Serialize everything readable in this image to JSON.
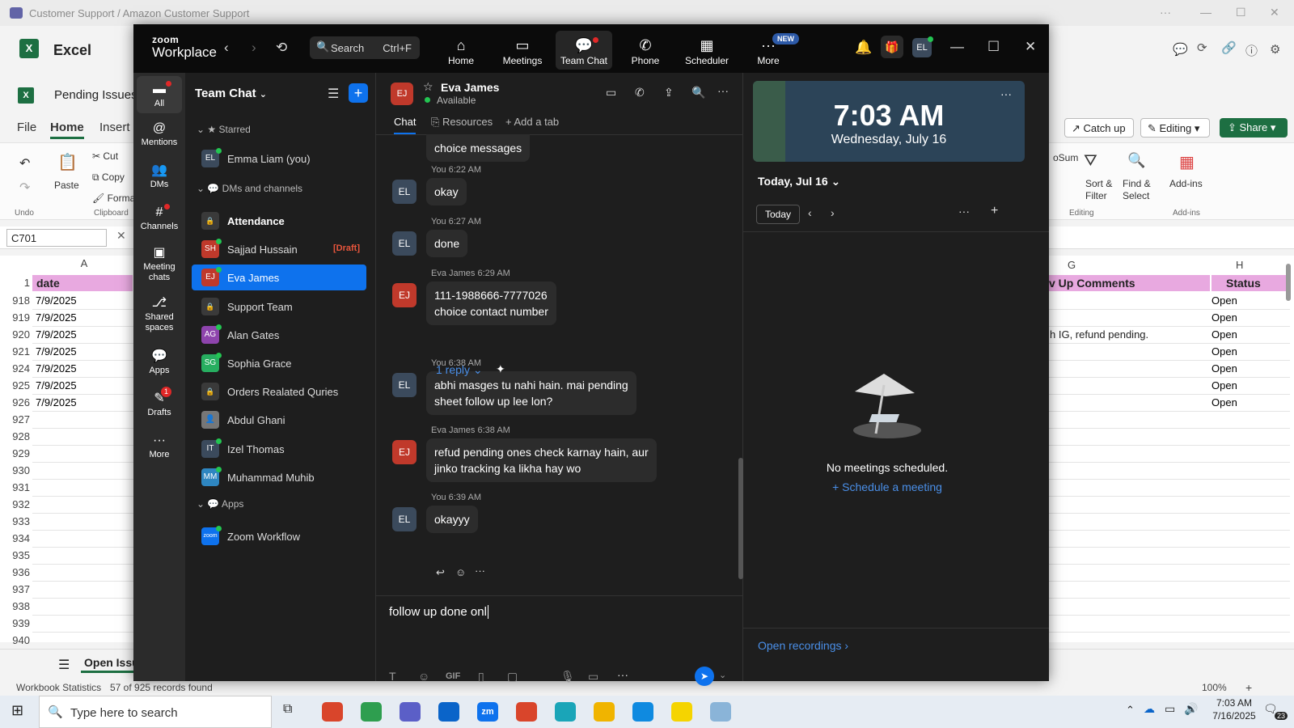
{
  "outer": {
    "title": "Customer Support / Amazon Customer Support",
    "min": "—",
    "max": "☐",
    "close": "✕",
    "more": "···"
  },
  "excel": {
    "app_name": "Excel",
    "file_name": "Pending Issues",
    "tabs": [
      "File",
      "Home",
      "Insert"
    ],
    "ribbon": {
      "undo": "Undo",
      "paste": "Paste",
      "cut": "Cut",
      "copy": "Copy",
      "format": "Forma",
      "clipboard": "Clipboard",
      "sort": "Sort &\nFilter",
      "find": "Find &\nSelect",
      "addins": "Add-ins",
      "editing_grp": "Editing",
      "addins_grp": "Add-ins",
      "autosum": "oSum"
    },
    "header_right": {
      "catch_up": "Catch up",
      "editing": "Editing",
      "share": "Share"
    },
    "name_box": "C701",
    "col_a": "A",
    "col_g": "G",
    "col_h": "H",
    "hdr_date": "date",
    "hdr_comments": "v Up Comments",
    "hdr_status": "Status",
    "row1": "1",
    "rows": [
      {
        "n": "918",
        "a": "7/9/2025",
        "g": "",
        "h": "Open"
      },
      {
        "n": "919",
        "a": "7/9/2025",
        "g": "",
        "h": "Open"
      },
      {
        "n": "920",
        "a": "7/9/2025",
        "g": "h IG, refund pending.",
        "h": "Open"
      },
      {
        "n": "921",
        "a": "7/9/2025",
        "g": "",
        "h": "Open"
      },
      {
        "n": "924",
        "a": "7/9/2025",
        "g": "",
        "h": "Open"
      },
      {
        "n": "925",
        "a": "7/9/2025",
        "g": "",
        "h": "Open"
      },
      {
        "n": "926",
        "a": "7/9/2025",
        "g": "",
        "h": "Open"
      },
      {
        "n": "927",
        "a": "",
        "g": "",
        "h": ""
      },
      {
        "n": "928",
        "a": "",
        "g": "",
        "h": ""
      },
      {
        "n": "929",
        "a": "",
        "g": "",
        "h": ""
      },
      {
        "n": "930",
        "a": "",
        "g": "",
        "h": ""
      },
      {
        "n": "931",
        "a": "",
        "g": "",
        "h": ""
      },
      {
        "n": "932",
        "a": "",
        "g": "",
        "h": ""
      },
      {
        "n": "933",
        "a": "",
        "g": "",
        "h": ""
      },
      {
        "n": "934",
        "a": "",
        "g": "",
        "h": ""
      },
      {
        "n": "935",
        "a": "",
        "g": "",
        "h": ""
      },
      {
        "n": "936",
        "a": "",
        "g": "",
        "h": ""
      },
      {
        "n": "937",
        "a": "",
        "g": "",
        "h": ""
      },
      {
        "n": "938",
        "a": "",
        "g": "",
        "h": ""
      },
      {
        "n": "939",
        "a": "",
        "g": "",
        "h": ""
      },
      {
        "n": "940",
        "a": "",
        "g": "",
        "h": ""
      }
    ],
    "sheet_tab": "Open Issu",
    "status_stats": "Workbook Statistics",
    "status_records": "57 of 925 records found",
    "zoom_pct": "100%"
  },
  "zoom": {
    "logo_top": "zoom",
    "logo_bottom": "Workplace",
    "search": {
      "label": "Search",
      "shortcut": "Ctrl+F"
    },
    "nav": [
      {
        "label": "Home",
        "icon": "home-icon"
      },
      {
        "label": "Meetings",
        "icon": "video-icon"
      },
      {
        "label": "Team Chat",
        "icon": "chat-icon"
      },
      {
        "label": "Phone",
        "icon": "phone-icon"
      },
      {
        "label": "Scheduler",
        "icon": "calendar-icon"
      },
      {
        "label": "More",
        "icon": "more-icon",
        "badge": "NEW"
      }
    ],
    "user_initials": "EL",
    "rail": [
      {
        "label": "All"
      },
      {
        "label": "Mentions"
      },
      {
        "label": "DMs"
      },
      {
        "label": "Channels"
      },
      {
        "label": "Meeting\nchats"
      },
      {
        "label": "Shared\nspaces"
      },
      {
        "label": "Apps"
      },
      {
        "label": "Drafts",
        "badge": "1"
      },
      {
        "label": "More"
      }
    ],
    "list": {
      "title": "Team Chat",
      "starred": "Starred",
      "dms": "DMs and channels",
      "apps": "Apps",
      "items": [
        {
          "initials": "EL",
          "name": "Emma Liam (you)",
          "color": "#3b4a5c"
        },
        {
          "initials": "",
          "name": "Attendance",
          "color": "#3a3a3a"
        },
        {
          "initials": "SH",
          "name": "Sajjad Hussain",
          "color": "#c0392b",
          "draft": "[Draft]"
        },
        {
          "initials": "EJ",
          "name": "Eva James",
          "color": "#c0392b"
        },
        {
          "initials": "",
          "name": "Support Team",
          "color": "#3a3a3a"
        },
        {
          "initials": "AG",
          "name": "Alan Gates",
          "color": "#8e44ad"
        },
        {
          "initials": "SG",
          "name": "Sophia Grace",
          "color": "#27ae60"
        },
        {
          "initials": "",
          "name": "Orders Realated Quries",
          "color": "#3a3a3a"
        },
        {
          "initials": "",
          "name": "Abdul Ghani",
          "color": "#777"
        },
        {
          "initials": "IT",
          "name": "Izel Thomas",
          "color": "#3b4a5c"
        },
        {
          "initials": "MM",
          "name": "Muhammad Muhib",
          "color": "#2e86c1"
        },
        {
          "initials": "zoom",
          "name": "Zoom Workflow",
          "color": "#0e72ed"
        }
      ]
    },
    "chat": {
      "contact_initials": "EJ",
      "contact_name": "Eva James",
      "contact_status": "Available",
      "tab_chat": "Chat",
      "tab_resources": "Resources",
      "tab_add": "Add a tab",
      "messages": [
        {
          "meta": "",
          "text": "choice messages",
          "av": ""
        },
        {
          "meta": "You 6:22 AM",
          "text": "okay",
          "av": "EL"
        },
        {
          "meta": "You 6:27 AM",
          "text": "done",
          "av": "EL"
        },
        {
          "meta": "Eva James 6:29 AM",
          "text": "111-1988666-7777026\nchoice contact number",
          "av": "EJ"
        },
        {
          "meta": "You 6:38 AM",
          "text": "abhi masges tu nahi hain. mai pending\nsheet follow up lee lon?",
          "av": "EL"
        },
        {
          "meta": "Eva James 6:38 AM",
          "text": "refud pending ones check karnay hain, aur\njinko tracking ka likha hay wo",
          "av": "EJ"
        },
        {
          "meta": "You 6:39 AM",
          "text": "okayyy",
          "av": "EL"
        }
      ],
      "reply_link": "1 reply",
      "compose_text": "follow up done onl"
    },
    "side": {
      "time": "7:03 AM",
      "date": "Wednesday, July 16",
      "today_header": "Today, Jul 16",
      "today_btn": "Today",
      "no_meetings": "No meetings scheduled.",
      "schedule": "Schedule a meeting",
      "recordings": "Open recordings"
    }
  },
  "taskbar": {
    "search_placeholder": "Type here to search",
    "time": "7:03 AM",
    "date": "7/16/2025",
    "notif": "23"
  }
}
